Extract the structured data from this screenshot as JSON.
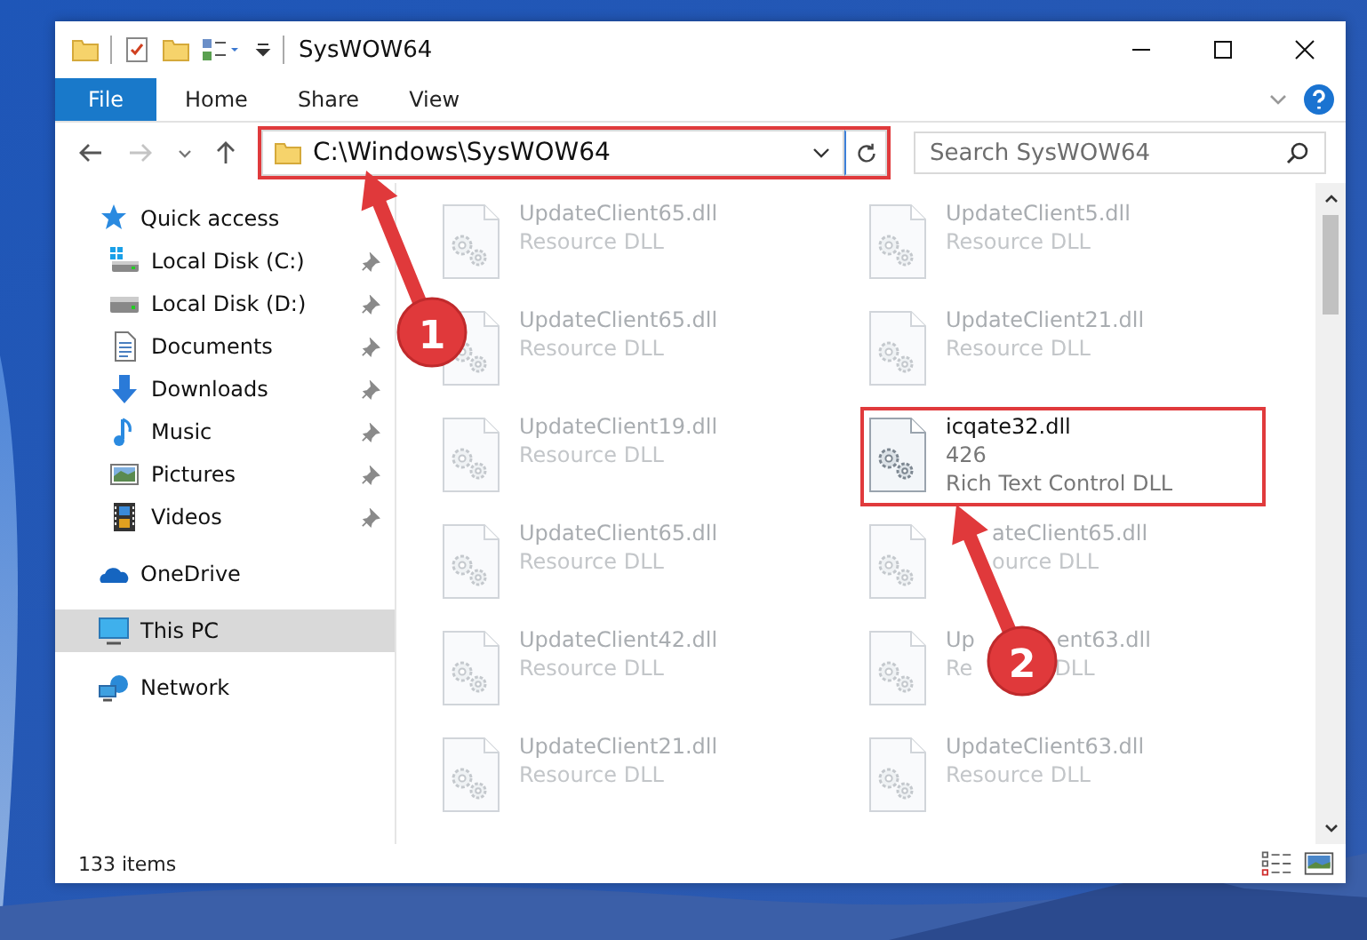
{
  "window": {
    "title": "SysWOW64"
  },
  "ribbon": {
    "tabs": [
      {
        "label": "File",
        "kind": "file",
        "selected": false
      },
      {
        "label": "Home",
        "kind": "tab",
        "selected": false
      },
      {
        "label": "Share",
        "kind": "tab",
        "selected": false
      },
      {
        "label": "View",
        "kind": "tab",
        "selected": false
      }
    ]
  },
  "address_bar": {
    "path": "C:\\Windows\\SysWOW64",
    "outlined": true
  },
  "search": {
    "placeholder": "Search SysWOW64"
  },
  "sidebar": {
    "items": [
      {
        "label": "Quick access",
        "selected": false,
        "children": [
          {
            "label": "Local Disk (C:)",
            "pinned": true,
            "selected": false
          },
          {
            "label": "Local Disk (D:)",
            "pinned": true,
            "selected": false
          },
          {
            "label": "Documents",
            "pinned": true,
            "selected": false
          },
          {
            "label": "Downloads",
            "pinned": true,
            "selected": false
          },
          {
            "label": "Music",
            "pinned": true,
            "selected": false
          },
          {
            "label": "Pictures",
            "pinned": true,
            "selected": false
          },
          {
            "label": "Videos",
            "pinned": true,
            "selected": false
          }
        ]
      },
      {
        "label": "OneDrive",
        "selected": false
      },
      {
        "label": "This PC",
        "selected": true
      },
      {
        "label": "Network",
        "selected": false
      }
    ]
  },
  "files": [
    {
      "name": [
        "UpdateClient65.dll"
      ],
      "type": [
        "Resource DLL"
      ],
      "blurred": true,
      "outlined": false
    },
    {
      "name": [
        "UpdateClient5.dll"
      ],
      "type": [
        "Resource DLL"
      ],
      "blurred": true,
      "outlined": false
    },
    {
      "name": [
        "UpdateClient65.dll"
      ],
      "type": [
        "Resource DLL"
      ],
      "blurred": true,
      "outlined": false
    },
    {
      "name": [
        "UpdateClient21.dll"
      ],
      "type": [
        "Resource DLL"
      ],
      "blurred": true,
      "outlined": false
    },
    {
      "name": [
        "UpdateClient19.dll"
      ],
      "type": [
        "Resource DLL"
      ],
      "blurred": true,
      "outlined": false
    },
    {
      "name": [
        "icqate32.dll"
      ],
      "size": "426",
      "type": [
        "Rich Text Control DLL"
      ],
      "blurred": false,
      "outlined": true
    },
    {
      "name": [
        "UpdateClient65.dll"
      ],
      "type": [
        "Resource DLL"
      ],
      "blurred": true,
      "outlined": false
    },
    {
      "name": [
        "ateClient65.dll"
      ],
      "type": [
        "ource DLL"
      ],
      "start_covered": true,
      "blurred": true,
      "outlined": false
    },
    {
      "name": [
        "UpdateClient42.dll"
      ],
      "type": [
        "Resource DLL"
      ],
      "blurred": true,
      "outlined": false
    },
    {
      "name": [
        "Up",
        "ent63.dll"
      ],
      "type": [
        "Re",
        "DLL"
      ],
      "blurred": true,
      "outlined": false
    },
    {
      "name": [
        "UpdateClient21.dll"
      ],
      "type": [
        "Resource DLL"
      ],
      "blurred": true,
      "outlined": false
    },
    {
      "name": [
        "UpdateClient63.dll"
      ],
      "type": [
        "Resource DLL"
      ],
      "blurred": true,
      "outlined": false
    }
  ],
  "status_bar": {
    "count": "133 items"
  },
  "annotations": [
    {
      "label": "1"
    },
    {
      "label": "2"
    }
  ]
}
